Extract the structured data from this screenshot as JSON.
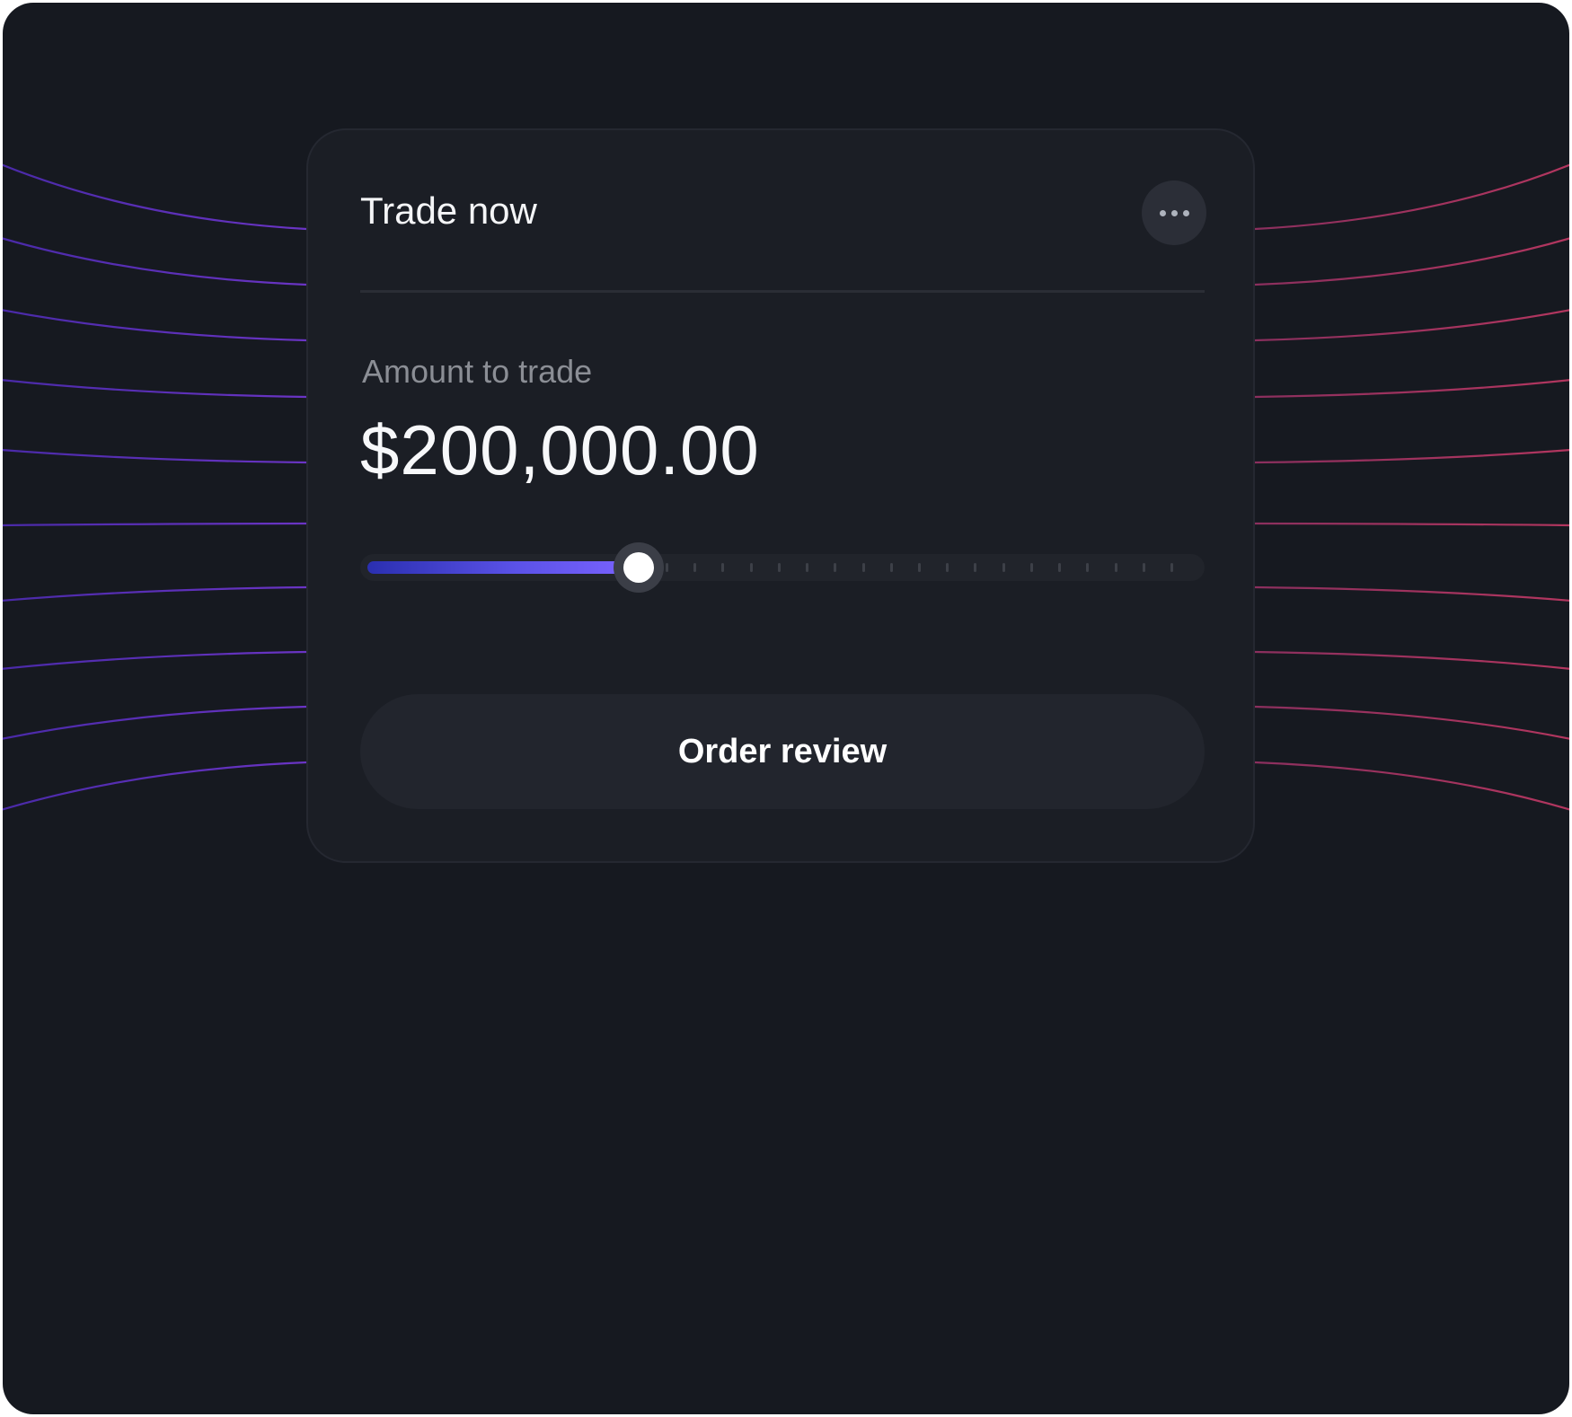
{
  "card": {
    "title": "Trade now",
    "more_icon": "more-horizontal-icon"
  },
  "amount": {
    "label": "Amount to trade",
    "value": "$200,000.00"
  },
  "slider": {
    "value_fraction": 0.33,
    "tick_count": 19
  },
  "actions": {
    "order_review_label": "Order review"
  },
  "colors": {
    "background": "#161920",
    "card": "#1b1e25",
    "accent_start": "#2a2fb0",
    "accent_end": "#7b63ff",
    "left_lines": "#5b2fb8",
    "right_lines": "#a3335f"
  }
}
